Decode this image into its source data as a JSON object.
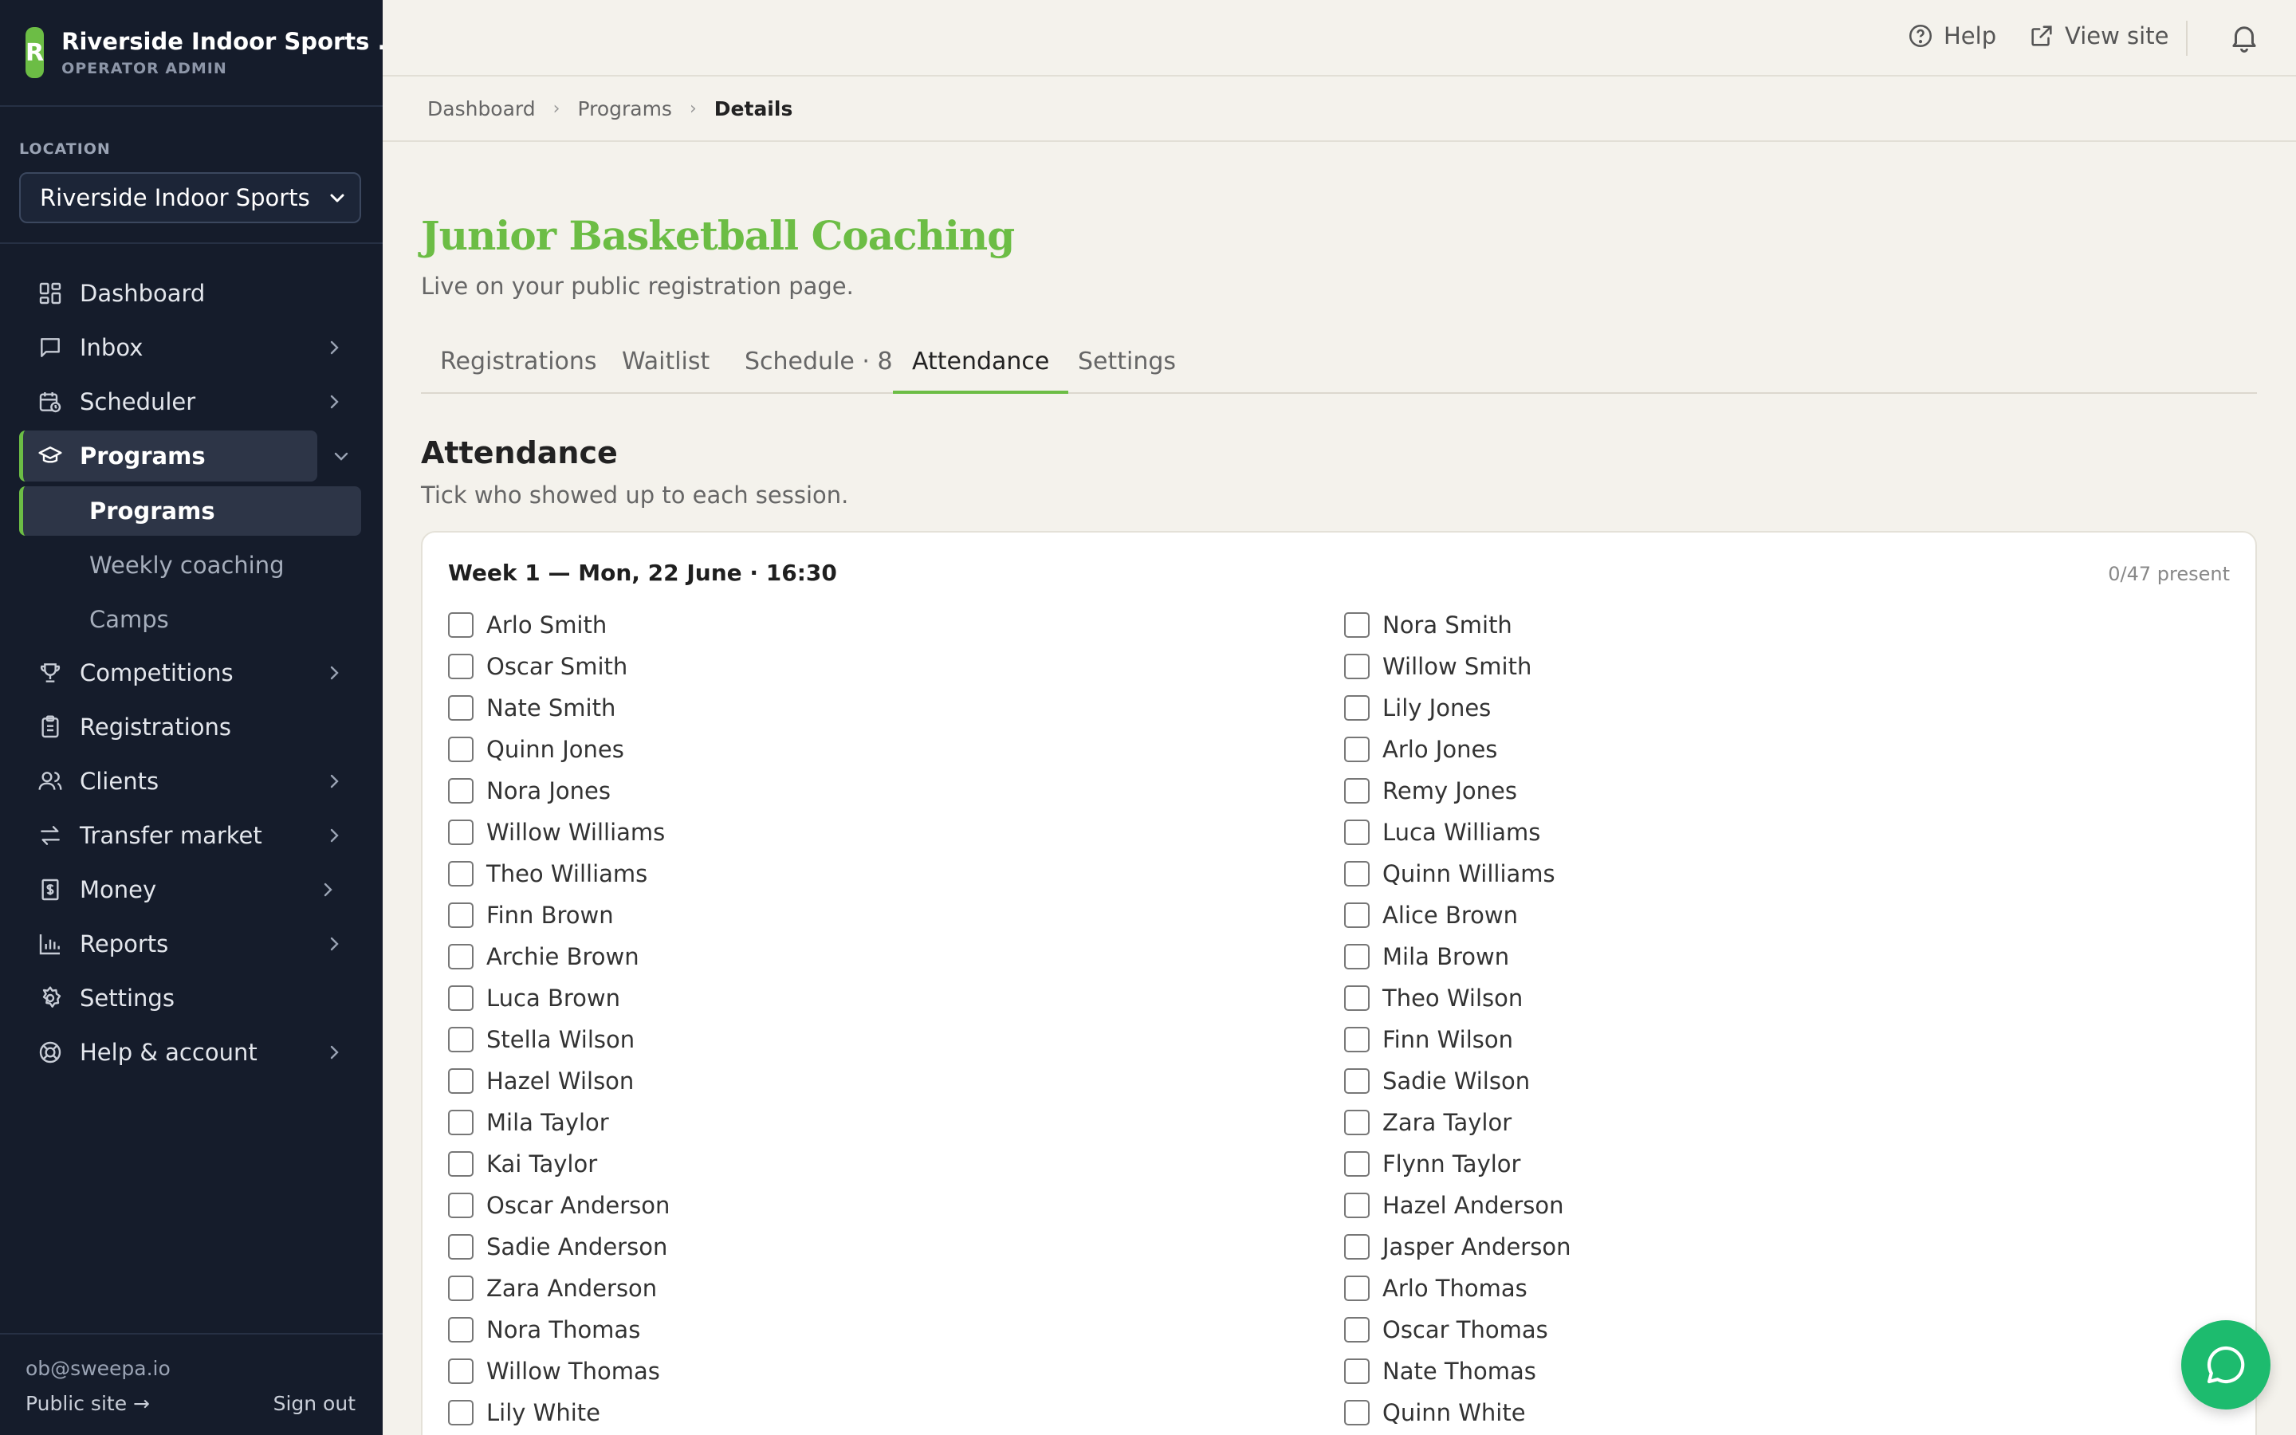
{
  "app": {
    "name": "Riverside Indoor Sports ...",
    "role": "OPERATOR ADMIN",
    "logo_letter": "R",
    "accent": "#6cbd45"
  },
  "location": {
    "label": "LOCATION",
    "selected": "Riverside Indoor Sports"
  },
  "nav": {
    "dashboard": "Dashboard",
    "inbox": "Inbox",
    "scheduler": "Scheduler",
    "programs": "Programs",
    "programs_sub": [
      "Programs",
      "Weekly coaching",
      "Camps"
    ],
    "competitions": "Competitions",
    "registrations": "Registrations",
    "clients": "Clients",
    "transfer_market": "Transfer market",
    "money": "Money",
    "reports": "Reports",
    "settings": "Settings",
    "help_account": "Help & account"
  },
  "footer": {
    "email": "ob@sweepa.io",
    "public_site": "Public site →",
    "sign_out": "Sign out"
  },
  "topbar": {
    "help": "Help",
    "view_site": "View site"
  },
  "breadcrumb": [
    "Dashboard",
    "Programs",
    "Details"
  ],
  "program": {
    "title": "Junior Basketball Coaching",
    "subtitle": "Live on your public registration page."
  },
  "tabs": [
    "Registrations",
    "Waitlist",
    "Schedule · 8",
    "Attendance",
    "Settings"
  ],
  "attendance": {
    "title": "Attendance",
    "subtitle": "Tick who showed up to each session.",
    "session_title": "Week 1 — Mon, 22 June · 16:30",
    "present_count": "0/47 present",
    "left_column": [
      "Arlo Smith",
      "Oscar Smith",
      "Nate Smith",
      "Quinn Jones",
      "Nora Jones",
      "Willow Williams",
      "Theo Williams",
      "Finn Brown",
      "Archie Brown",
      "Luca Brown",
      "Stella Wilson",
      "Hazel Wilson",
      "Mila Taylor",
      "Kai Taylor",
      "Oscar Anderson",
      "Sadie Anderson",
      "Zara Anderson",
      "Nora Thomas",
      "Willow Thomas",
      "Lily White"
    ],
    "right_column": [
      "Nora Smith",
      "Willow Smith",
      "Lily Jones",
      "Arlo Jones",
      "Remy Jones",
      "Luca Williams",
      "Quinn Williams",
      "Alice Brown",
      "Mila Brown",
      "Theo Wilson",
      "Finn Wilson",
      "Sadie Wilson",
      "Zara Taylor",
      "Flynn Taylor",
      "Hazel Anderson",
      "Jasper Anderson",
      "Arlo Thomas",
      "Oscar Thomas",
      "Nate Thomas",
      "Quinn White"
    ]
  },
  "icons": {
    "chat": "chat-bubble-icon",
    "bell": "bell-icon"
  }
}
